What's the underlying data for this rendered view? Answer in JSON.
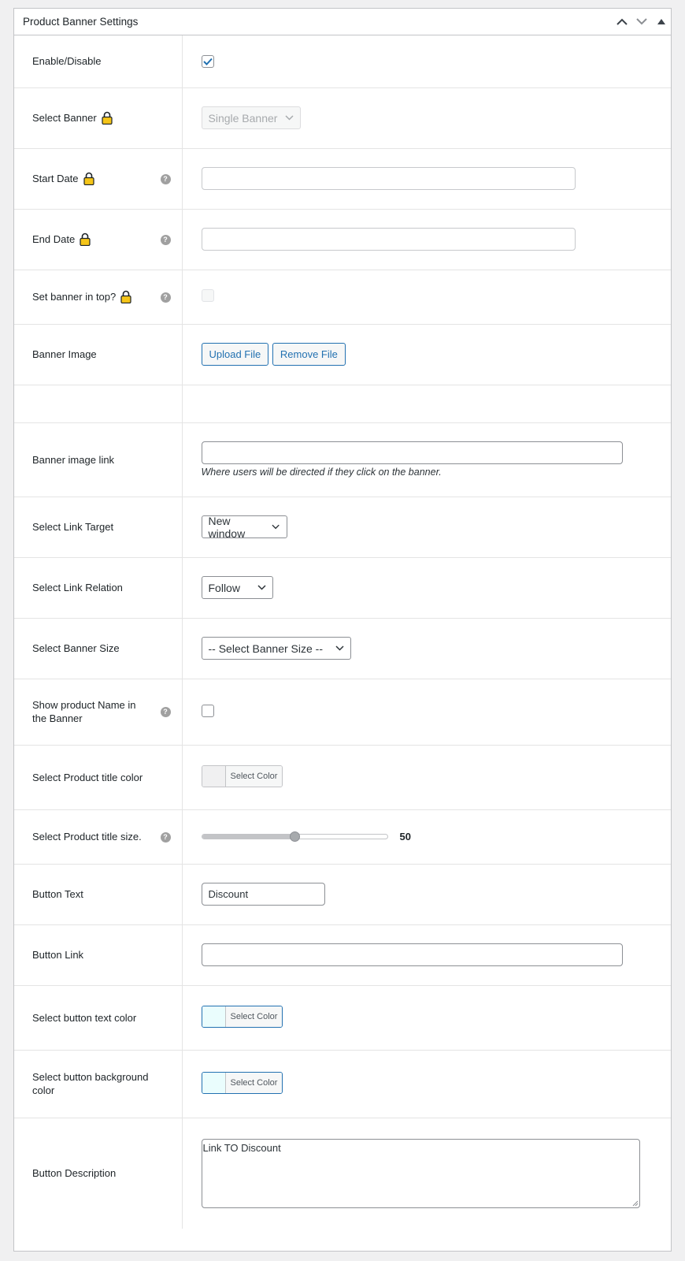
{
  "panel": {
    "title": "Product Banner Settings"
  },
  "icons": {
    "move_up": "chevron-up-icon",
    "move_down": "chevron-down-icon",
    "toggle": "triangle-up-icon",
    "lock": "lock-icon",
    "help": "help-icon"
  },
  "colors": {
    "accent": "#2271b1",
    "lock": "#f5c518",
    "border": "#c3c4c7",
    "swatch_light": "#f0f0f1",
    "swatch_cyan": "#eafdfd"
  },
  "fields": {
    "enable": {
      "label": "Enable/Disable",
      "checked": true
    },
    "select_banner": {
      "label": "Select Banner",
      "value": "Single Banner"
    },
    "start_date": {
      "label": "Start Date",
      "value": ""
    },
    "end_date": {
      "label": "End Date",
      "value": ""
    },
    "banner_top": {
      "label": "Set banner in top?",
      "checked": false
    },
    "banner_image": {
      "label": "Banner Image",
      "upload_label": "Upload File",
      "remove_label": "Remove File"
    },
    "banner_link": {
      "label": "Banner image link",
      "value": "",
      "description": "Where users will be directed if they click on the banner."
    },
    "link_target": {
      "label": "Select Link Target",
      "value": "New window"
    },
    "link_relation": {
      "label": "Select Link Relation",
      "value": "Follow"
    },
    "banner_size": {
      "label": "Select Banner Size",
      "value": "-- Select Banner Size --"
    },
    "show_name": {
      "label": "Show product Name in the Banner",
      "checked": false
    },
    "title_color": {
      "label": "Select Product title color",
      "button_label": "Select Color"
    },
    "title_size": {
      "label": "Select Product title size.",
      "value": 50,
      "fraction": 0.5
    },
    "button_text": {
      "label": "Button Text",
      "value": "Discount"
    },
    "button_link": {
      "label": "Button Link",
      "value": ""
    },
    "button_text_color": {
      "label": "Select button text color",
      "button_label": "Select Color"
    },
    "button_bg_color": {
      "label": "Select button background color",
      "button_label": "Select Color"
    },
    "button_description": {
      "label": "Button Description",
      "value": "Link TO Discount"
    }
  }
}
